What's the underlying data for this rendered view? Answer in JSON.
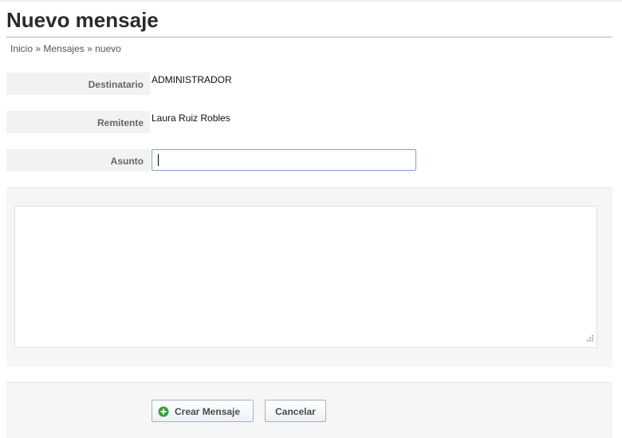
{
  "page": {
    "title": "Nuevo mensaje"
  },
  "breadcrumb": {
    "items": [
      "Inicio",
      "Mensajes",
      "nuevo"
    ],
    "separator": "»"
  },
  "form": {
    "recipient": {
      "label": "Destinatario",
      "value": "ADMINISTRADOR"
    },
    "sender": {
      "label": "Remitente",
      "value": "Laura Ruiz Robles"
    },
    "subject": {
      "label": "Asunto",
      "value": ""
    },
    "body": {
      "value": ""
    }
  },
  "actions": {
    "create_label": "Crear Mensaje",
    "create_icon": "plus-circle-icon",
    "cancel_label": "Cancelar"
  },
  "colors": {
    "accent_green": "#3aa23a",
    "input_border": "#7da2ce"
  }
}
